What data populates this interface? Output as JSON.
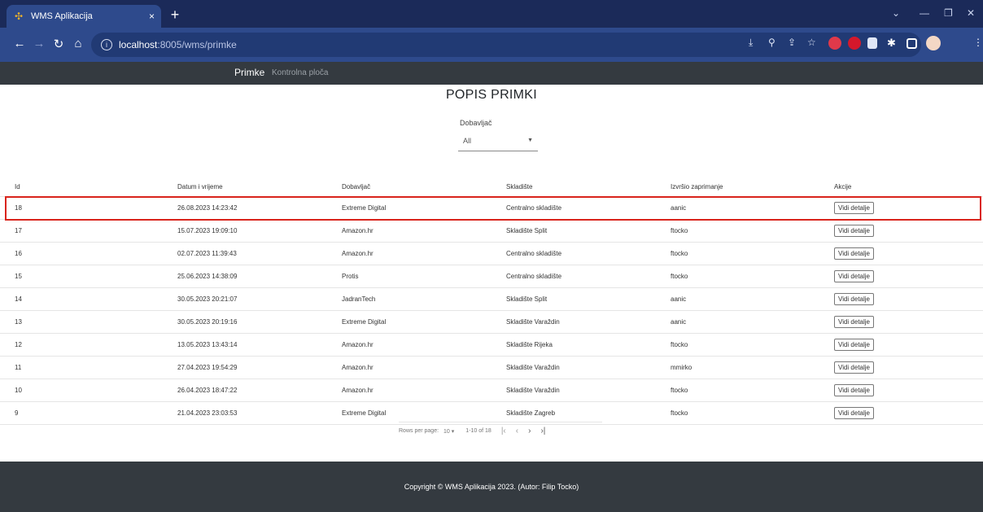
{
  "browser": {
    "tab_title": "WMS Aplikacija",
    "tab_close": "×",
    "new_tab": "+",
    "url_host": "localhost",
    "url_path": ":8005/wms/primke"
  },
  "navbar": {
    "brand": "Primke",
    "link": "Kontrolna ploča"
  },
  "page": {
    "title": "POPIS PRIMKI"
  },
  "filter": {
    "label": "Dobavljač",
    "value": "All"
  },
  "table": {
    "headers": [
      "Id",
      "Datum i vrijeme",
      "Dobavljač",
      "Skladište",
      "Izvršio zaprimanje",
      "Akcije"
    ],
    "action_label": "Vidi detalje",
    "rows": [
      {
        "id": "18",
        "datetime": "26.08.2023 14:23:42",
        "supplier": "Extreme Digital",
        "warehouse": "Centralno skladište",
        "user": "aanic"
      },
      {
        "id": "17",
        "datetime": "15.07.2023 19:09:10",
        "supplier": "Amazon.hr",
        "warehouse": "Skladište Split",
        "user": "ftocko"
      },
      {
        "id": "16",
        "datetime": "02.07.2023 11:39:43",
        "supplier": "Amazon.hr",
        "warehouse": "Centralno skladište",
        "user": "ftocko"
      },
      {
        "id": "15",
        "datetime": "25.06.2023 14:38:09",
        "supplier": "Protis",
        "warehouse": "Centralno skladište",
        "user": "ftocko"
      },
      {
        "id": "14",
        "datetime": "30.05.2023 20:21:07",
        "supplier": "JadranTech",
        "warehouse": "Skladište Split",
        "user": "aanic"
      },
      {
        "id": "13",
        "datetime": "30.05.2023 20:19:16",
        "supplier": "Extreme Digital",
        "warehouse": "Skladište Varaždin",
        "user": "aanic"
      },
      {
        "id": "12",
        "datetime": "13.05.2023 13:43:14",
        "supplier": "Amazon.hr",
        "warehouse": "Skladište Rijeka",
        "user": "ftocko"
      },
      {
        "id": "11",
        "datetime": "27.04.2023 19:54:29",
        "supplier": "Amazon.hr",
        "warehouse": "Skladište Varaždin",
        "user": "mmirko"
      },
      {
        "id": "10",
        "datetime": "26.04.2023 18:47:22",
        "supplier": "Amazon.hr",
        "warehouse": "Skladište Varaždin",
        "user": "ftocko"
      },
      {
        "id": "9",
        "datetime": "21.04.2023 23:03:53",
        "supplier": "Extreme Digital",
        "warehouse": "Skladište Zagreb",
        "user": "ftocko"
      }
    ]
  },
  "pagination": {
    "rows_per_page_label": "Rows per page:",
    "rows_per_page_value": "10",
    "range": "1-10 of 18"
  },
  "footer": {
    "text": "Copyright © WMS Aplikacija 2023. (Autor: Filip Tocko)"
  },
  "colors": {
    "navbar": "#343a40",
    "highlight": "#d9241c",
    "tabbar": "#1b2a59",
    "addressbar": "#2e4a8c"
  }
}
